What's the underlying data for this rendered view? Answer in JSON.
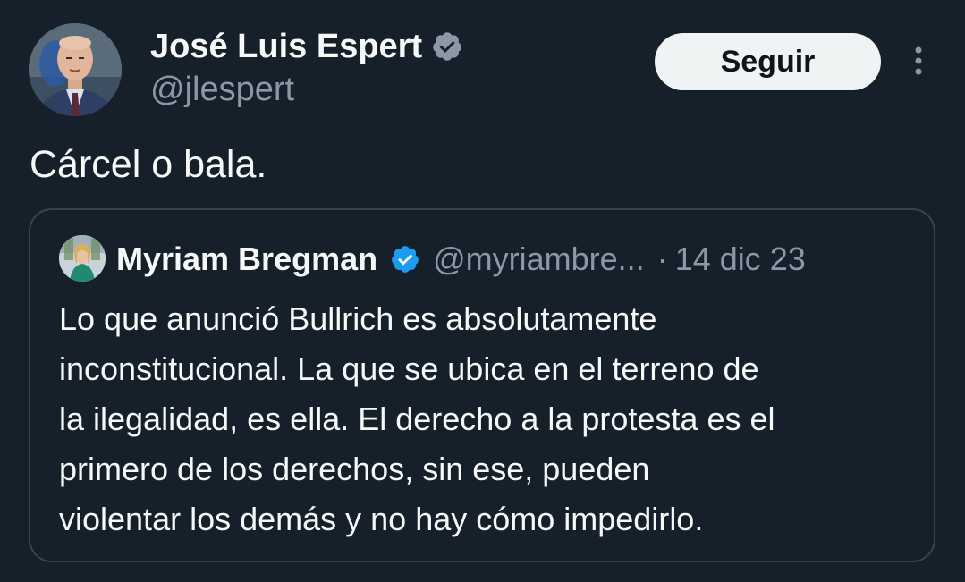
{
  "author": {
    "name": "José Luis Espert",
    "handle": "@jlespert",
    "avatar_icon": "avatar-photo",
    "verified_icon": "verified-badge-icon"
  },
  "actions": {
    "follow_label": "Seguir",
    "more_icon": "more-vertical-icon"
  },
  "tweet": {
    "text": "Cárcel o bala."
  },
  "quoted": {
    "name": "Myriam Bregman",
    "handle": "@myriambre...",
    "separator": "·",
    "date": "14 dic 23",
    "verified_icon": "verified-badge-icon",
    "body_lines": [
      "Lo que anunció Bullrich es absolutamente",
      "inconstitucional. La que se ubica en el terreno de",
      "la ilegalidad, es ella. El derecho a la protesta es el",
      "primero de los derechos,  sin ese, pueden",
      "violentar los demás y no hay cómo impedirlo."
    ]
  },
  "colors": {
    "background": "#15202b",
    "text_primary": "#f7f9f9",
    "text_secondary": "#8b98a5",
    "verified_badge": "#1d9bf0",
    "button_bg": "#eff3f4",
    "border": "#38444d"
  }
}
